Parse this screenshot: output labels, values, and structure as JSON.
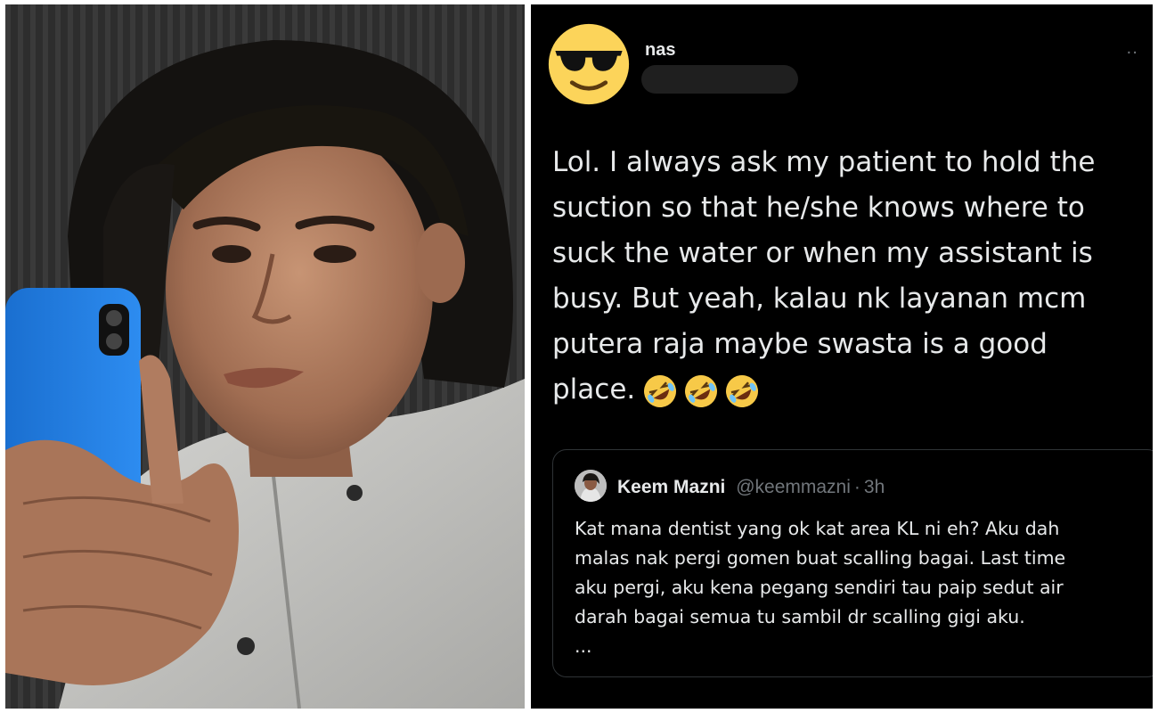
{
  "tweet": {
    "author_name": "nas",
    "body_lines": [
      "Lol. I always ask my patient to hold the",
      "suction so that he/she knows where to",
      "suck the water or when my assistant is",
      "busy. But yeah, kalau nk layanan mcm",
      "putera raja maybe swasta is a good",
      "place."
    ],
    "trailing_emojis": [
      "rolling-on-floor-laughing",
      "rolling-on-floor-laughing",
      "rolling-on-floor-laughing"
    ],
    "more_label": "··"
  },
  "quoted_tweet": {
    "author_name": "Keem Mazni",
    "handle": "@keemmazni",
    "separator": "·",
    "time": "3h",
    "body_lines": [
      "Kat mana dentist yang ok kat area KL ni eh? Aku dah",
      "malas nak pergi gomen buat scalling bagai. Last time",
      "aku pergi, aku kena pegang sendiri tau paip sedut air",
      "darah bagai semua tu sambil dr scalling gigi aku.",
      "..."
    ]
  },
  "colors": {
    "tweet_background": "#000000",
    "primary_text": "#e7e9ea",
    "secondary_text": "#71767b",
    "card_border": "#2f3336",
    "phone_case": "#1f7fe0"
  }
}
